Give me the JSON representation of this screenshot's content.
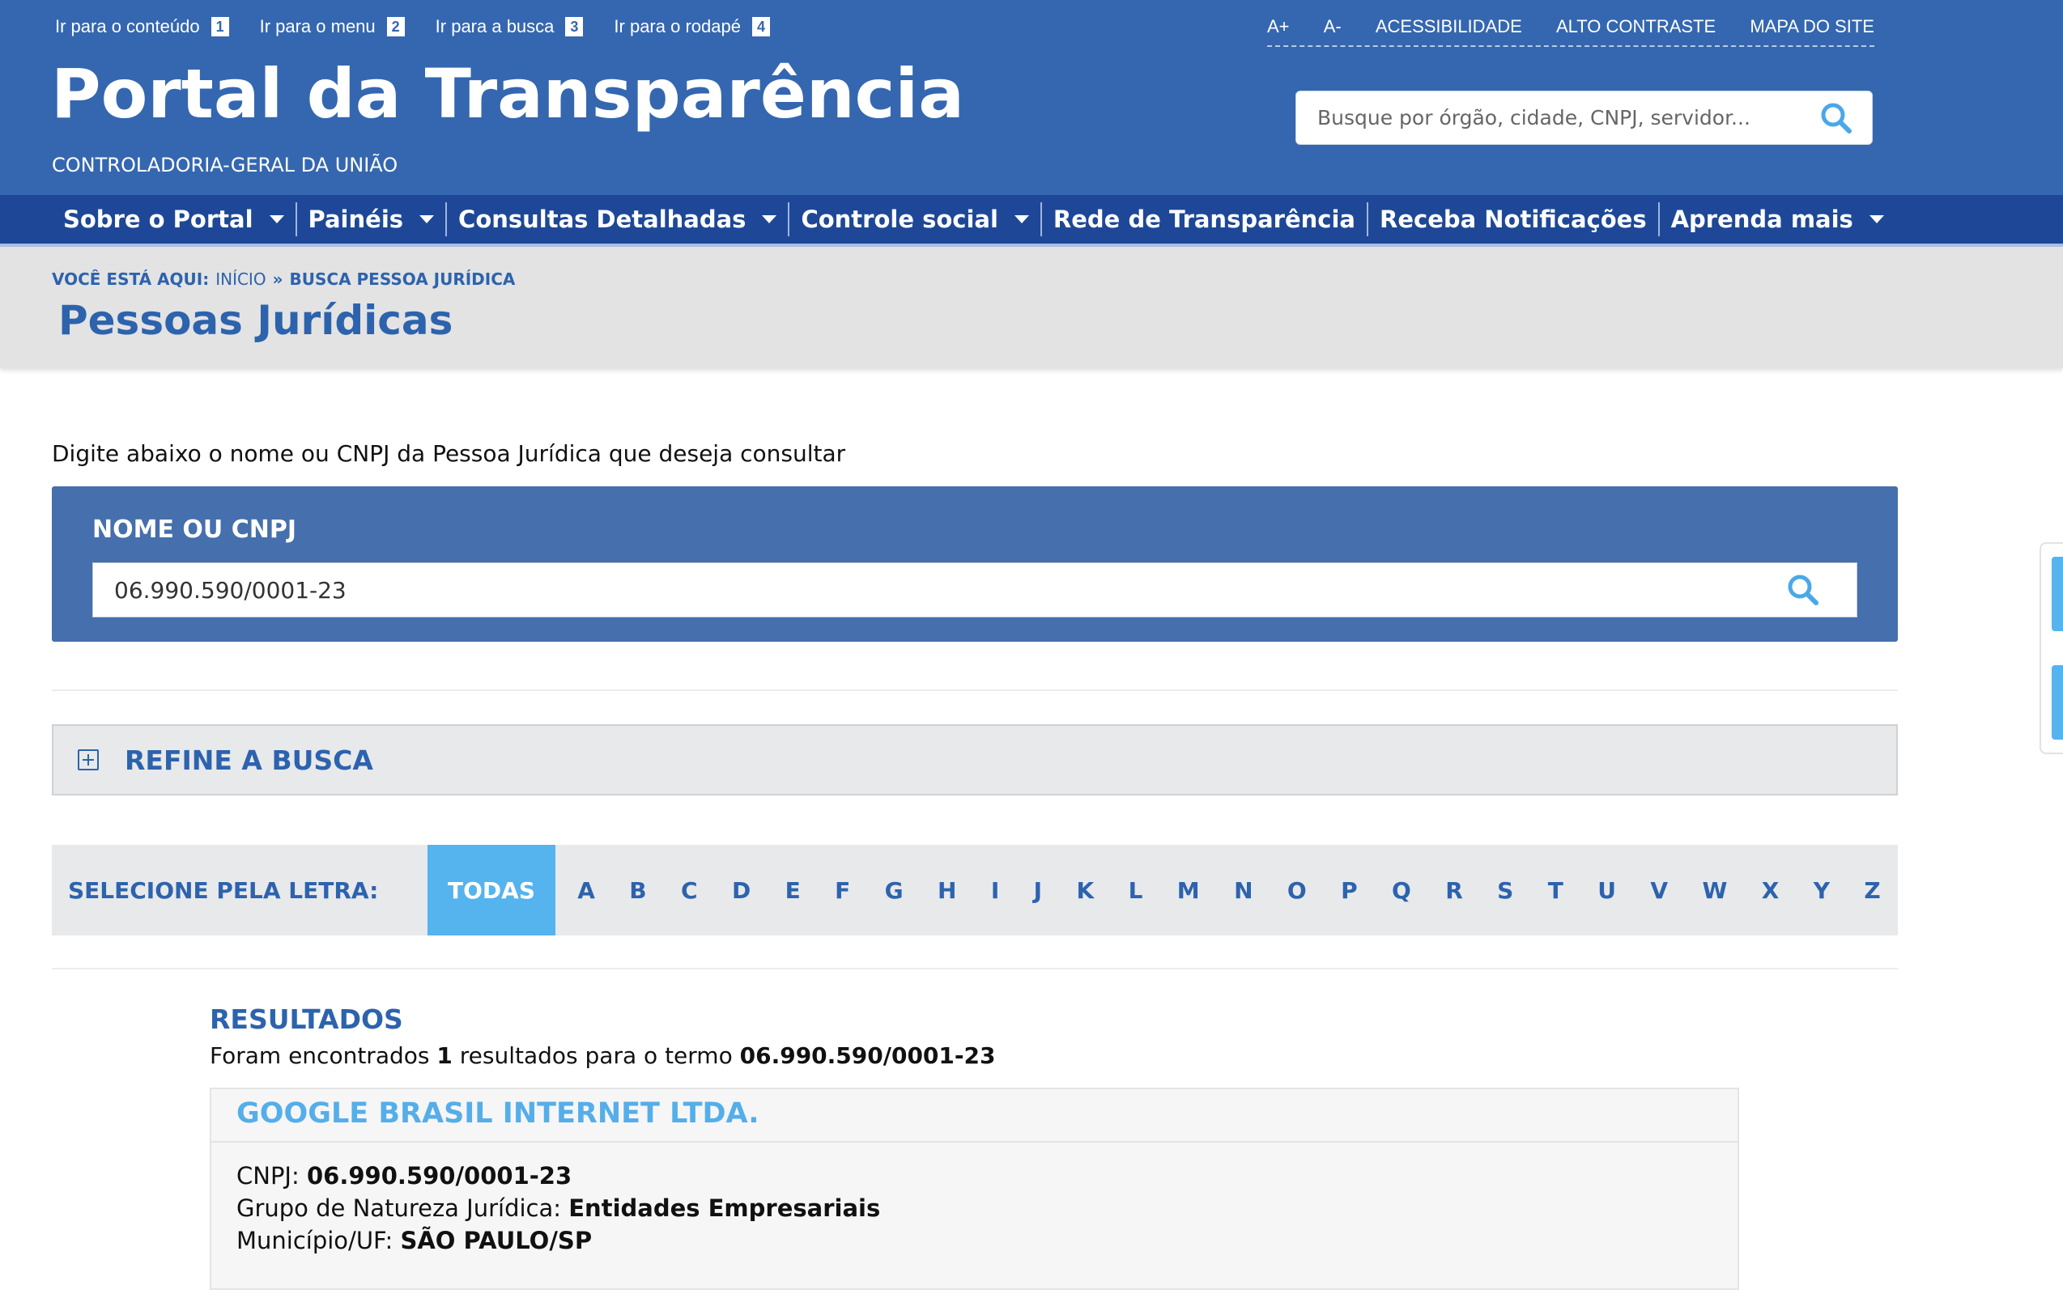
{
  "skip_links": [
    {
      "label": "Ir para o conteúdo",
      "num": "1"
    },
    {
      "label": "Ir para o menu",
      "num": "2"
    },
    {
      "label": "Ir para a busca",
      "num": "3"
    },
    {
      "label": "Ir para o rodapé",
      "num": "4"
    }
  ],
  "utility": {
    "increase": "A+",
    "decrease": "A-",
    "accessibility": "ACESSIBILIDADE",
    "contrast": "ALTO CONTRASTE",
    "sitemap": "MAPA DO SITE"
  },
  "brand": {
    "title": "Portal da Transparência",
    "subtitle": "CONTROLADORIA-GERAL DA UNIÃO"
  },
  "global_search": {
    "placeholder": "Busque por órgão, cidade, CNPJ, servidor..."
  },
  "nav": [
    {
      "label": "Sobre o Portal"
    },
    {
      "label": "Painéis"
    },
    {
      "label": "Consultas Detalhadas"
    },
    {
      "label": "Controle social"
    },
    {
      "label": "Rede de Transparência"
    },
    {
      "label": "Receba Notificações"
    },
    {
      "label": "Aprenda mais"
    }
  ],
  "breadcrumb": {
    "prefix": "VOCÊ ESTÁ AQUI:",
    "home": "INÍCIO",
    "sep": "»",
    "current": "BUSCA PESSOA JURÍDICA"
  },
  "page_title": "Pessoas Jurídicas",
  "intro": "Digite abaixo o nome ou CNPJ da Pessoa Jurídica que deseja consultar",
  "query": {
    "label": "NOME OU CNPJ",
    "value": "06.990.590/0001-23"
  },
  "refine": {
    "label": "REFINE A BUSCA"
  },
  "letters": {
    "label": "SELECIONE PELA LETRA:",
    "all": "TODAS",
    "items": [
      "A",
      "B",
      "C",
      "D",
      "E",
      "F",
      "G",
      "H",
      "I",
      "J",
      "K",
      "L",
      "M",
      "N",
      "O",
      "P",
      "Q",
      "R",
      "S",
      "T",
      "U",
      "V",
      "W",
      "X",
      "Y",
      "Z"
    ]
  },
  "results": {
    "title": "RESULTADOS",
    "summary_prefix": "Foram encontrados",
    "count": "1",
    "summary_middle": "resultados para o termo",
    "term": "06.990.590/0001-23",
    "items": [
      {
        "name": "GOOGLE BRASIL INTERNET LTDA.",
        "cnpj_label": "CNPJ:",
        "cnpj": "06.990.590/0001-23",
        "nature_label": "Grupo de Natureza Jurídica:",
        "nature": "Entidades Empresariais",
        "city_label": "Município/UF:",
        "city": "SÃO PAULO/SP"
      }
    ]
  },
  "colors": {
    "header_blue": "#3567b0",
    "nav_blue": "#1e4897",
    "link_blue": "#2d63ad",
    "accent_cyan": "#55b3ee"
  }
}
